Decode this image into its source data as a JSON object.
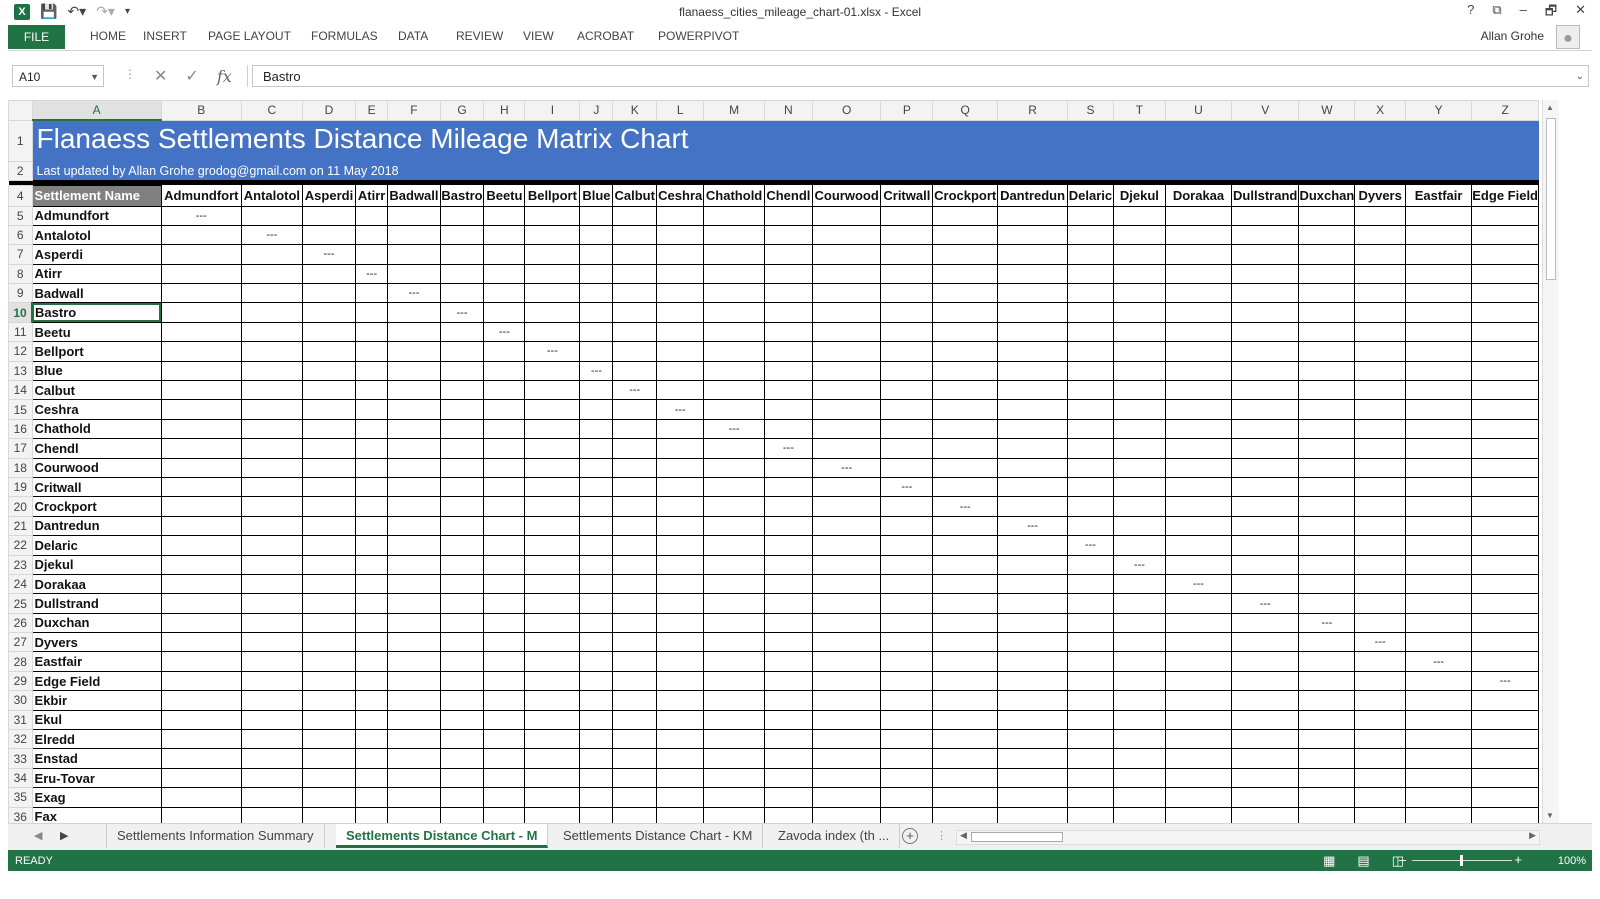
{
  "window": {
    "title": "flanaess_cities_mileage_chart-01.xlsx - Excel",
    "app_logo": "X",
    "controls": [
      "?",
      "⧉",
      "–",
      "🗗",
      "✕"
    ]
  },
  "ribbon": {
    "file_label": "FILE",
    "tabs": [
      "HOME",
      "INSERT",
      "PAGE LAYOUT",
      "FORMULAS",
      "DATA",
      "REVIEW",
      "VIEW",
      "ACROBAT",
      "POWERPIVOT"
    ],
    "user": "Allan Grohe"
  },
  "formula_bar": {
    "name_box": "A10",
    "formula": "Bastro"
  },
  "columns": [
    "A",
    "B",
    "C",
    "D",
    "E",
    "F",
    "G",
    "H",
    "I",
    "J",
    "K",
    "L",
    "M",
    "N",
    "O",
    "P",
    "Q",
    "R",
    "S",
    "T",
    "U",
    "V",
    "W",
    "X",
    "Y",
    "Z"
  ],
  "sheet": {
    "title": "Flanaess Settlements Distance Mileage Matrix Chart",
    "subtitle": "Last updated by Allan Grohe grodog@gmail.com on 11 May 2018",
    "header_label": "Settlement Name",
    "col_names": [
      "Admundfort",
      "Antalotol",
      "Asperdi",
      "Atirr",
      "Badwall",
      "Bastro",
      "Beetu",
      "Bellport",
      "Blue",
      "Calbut",
      "Ceshra",
      "Chathold",
      "Chendl",
      "Courwood",
      "Critwall",
      "Crockport",
      "Dantredun",
      "Delaric",
      "Djekul",
      "Dorakaa",
      "Dullstrand",
      "Duxchan",
      "Dyvers",
      "Eastfair",
      "Edge Field"
    ],
    "row_names": [
      "Admundfort",
      "Antalotol",
      "Asperdi",
      "Atirr",
      "Badwall",
      "Bastro",
      "Beetu",
      "Bellport",
      "Blue",
      "Calbut",
      "Ceshra",
      "Chathold",
      "Chendl",
      "Courwood",
      "Critwall",
      "Crockport",
      "Dantredun",
      "Delaric",
      "Djekul",
      "Dorakaa",
      "Dullstrand",
      "Duxchan",
      "Dyvers",
      "Eastfair",
      "Edge Field",
      "Ekbir",
      "Ekul",
      "Elredd",
      "Enstad",
      "Eru-Tovar",
      "Exag",
      "Fax"
    ],
    "diagonal_marker": "---"
  },
  "sheet_tabs": [
    "Settlements Information Summary",
    "Settlements Distance Chart - M",
    "Settlements Distance Chart - KM",
    "Zavoda index (th  ..."
  ],
  "active_tab_index": 1,
  "status": {
    "ready": "READY",
    "zoom": "100%"
  }
}
